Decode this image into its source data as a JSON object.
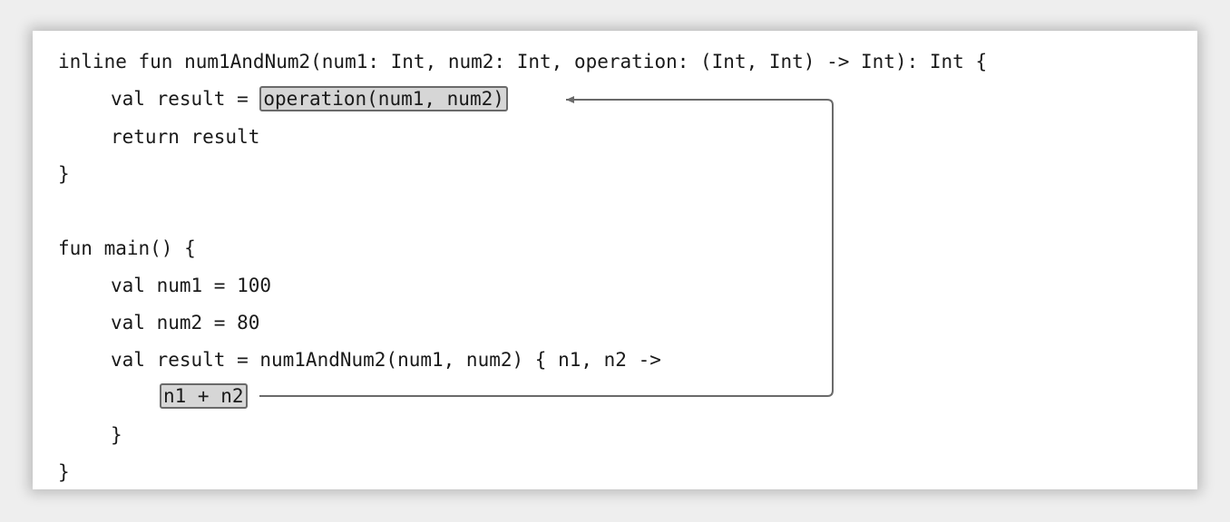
{
  "code": {
    "line1": "inline fun num1AndNum2(num1: Int, num2: Int, operation: (Int, Int) -> Int): Int {",
    "line2_prefix": "val result = ",
    "line2_highlight": "operation(num1, num2)",
    "line3": "return result",
    "line4": "}",
    "line6": "fun main() {",
    "line7": "val num1 = 100",
    "line8": "val num2 = 80",
    "line9": "val result = num1AndNum2(num1, num2) { n1, n2 ->",
    "line10_highlight": "n1 + n2",
    "line11": "}",
    "line12": "}"
  },
  "colors": {
    "highlight_bg": "#d6d6d6",
    "highlight_border": "#6a6a6a",
    "arrow": "#6a6a6a"
  }
}
